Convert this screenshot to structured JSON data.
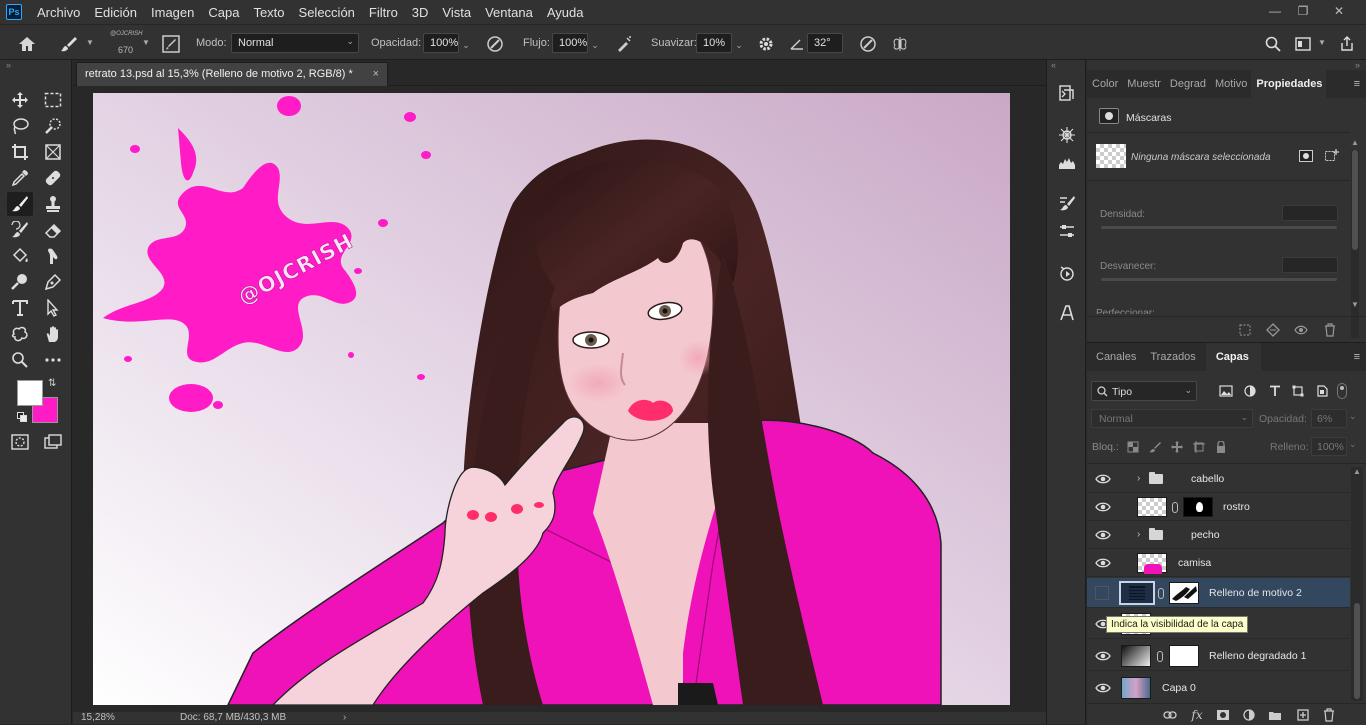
{
  "menu": {
    "items": [
      "Archivo",
      "Edición",
      "Imagen",
      "Capa",
      "Texto",
      "Selección",
      "Filtro",
      "3D",
      "Vista",
      "Ventana",
      "Ayuda"
    ],
    "app_logo": "Ps"
  },
  "options": {
    "brush_size": "670",
    "brush_preset_label": "@OJCRISH",
    "mode_label": "Modo:",
    "mode_value": "Normal",
    "opacity_label": "Opacidad:",
    "opacity_value": "100%",
    "flow_label": "Flujo:",
    "flow_value": "100%",
    "smooth_label": "Suavizar:",
    "smooth_value": "10%",
    "angle_value": "32°"
  },
  "document": {
    "tab_title": "retrato 13.psd al 15,3% (Relleno de motivo 2, RGB/8) *",
    "tab_close": "×",
    "zoom": "15,28%",
    "doc_info": "Doc: 68,7 MB/430,3 MB",
    "watermark_text": "@OJCRISH",
    "colors": {
      "background_top": "#f4eef6",
      "background_bottom": "#c9a8c6",
      "splash": "#ff1cc6",
      "shirt": "#ee12b8",
      "hair": "#3a1d1d",
      "skin": "#f4c8cf",
      "lips": "#ff2d6a"
    }
  },
  "properties_panel": {
    "tabs": [
      "Color",
      "Muestr",
      "Degrad",
      "Motivo",
      "Propiedades"
    ],
    "active_tab": "Propiedades",
    "section": "Máscaras",
    "mask_status": "Ninguna máscara seleccionada",
    "density_label": "Densidad:",
    "feather_label": "Desvanecer:",
    "refine_label": "Perfeccionar:"
  },
  "layers_panel": {
    "tabs": [
      "Canales",
      "Trazados",
      "Capas"
    ],
    "active_tab": "Capas",
    "filter_label": "Tipo",
    "blend_mode": "Normal",
    "opacity_label": "Opacidad:",
    "opacity_value": "6%",
    "lock_label": "Bloq.:",
    "fill_label": "Relleno:",
    "fill_value": "100%",
    "layers": [
      {
        "name": "cabello",
        "kind": "group",
        "visible": true
      },
      {
        "name": "rostro",
        "kind": "masked",
        "visible": true
      },
      {
        "name": "pecho",
        "kind": "group",
        "visible": true
      },
      {
        "name": "camisa",
        "kind": "layer",
        "visible": true
      },
      {
        "name": "Relleno de motivo 2",
        "kind": "pattern-fill",
        "visible": false,
        "selected": true
      },
      {
        "name": "Relleno degradado 1",
        "kind": "gradient-fill",
        "visible": true
      },
      {
        "name": "Capa 0",
        "kind": "image",
        "visible": true
      }
    ],
    "tooltip": "Indica la visibilidad de la capa",
    "bottom_icons": [
      "link-icon",
      "fx-icon",
      "mask-icon",
      "adjustment-icon",
      "folder-icon",
      "new-layer-icon",
      "trash-icon"
    ]
  },
  "toolbar": {
    "tools": [
      "move",
      "marquee",
      "lasso",
      "quick-select",
      "crop",
      "frame",
      "eyedropper",
      "healing",
      "brush",
      "stamp",
      "history-brush",
      "eraser",
      "paint-bucket",
      "smudge",
      "dodge",
      "pen",
      "type",
      "path-select",
      "shape",
      "hand",
      "zoom",
      "more"
    ],
    "foreground_color": "#ffffff",
    "background_color": "#ff1cc6"
  }
}
